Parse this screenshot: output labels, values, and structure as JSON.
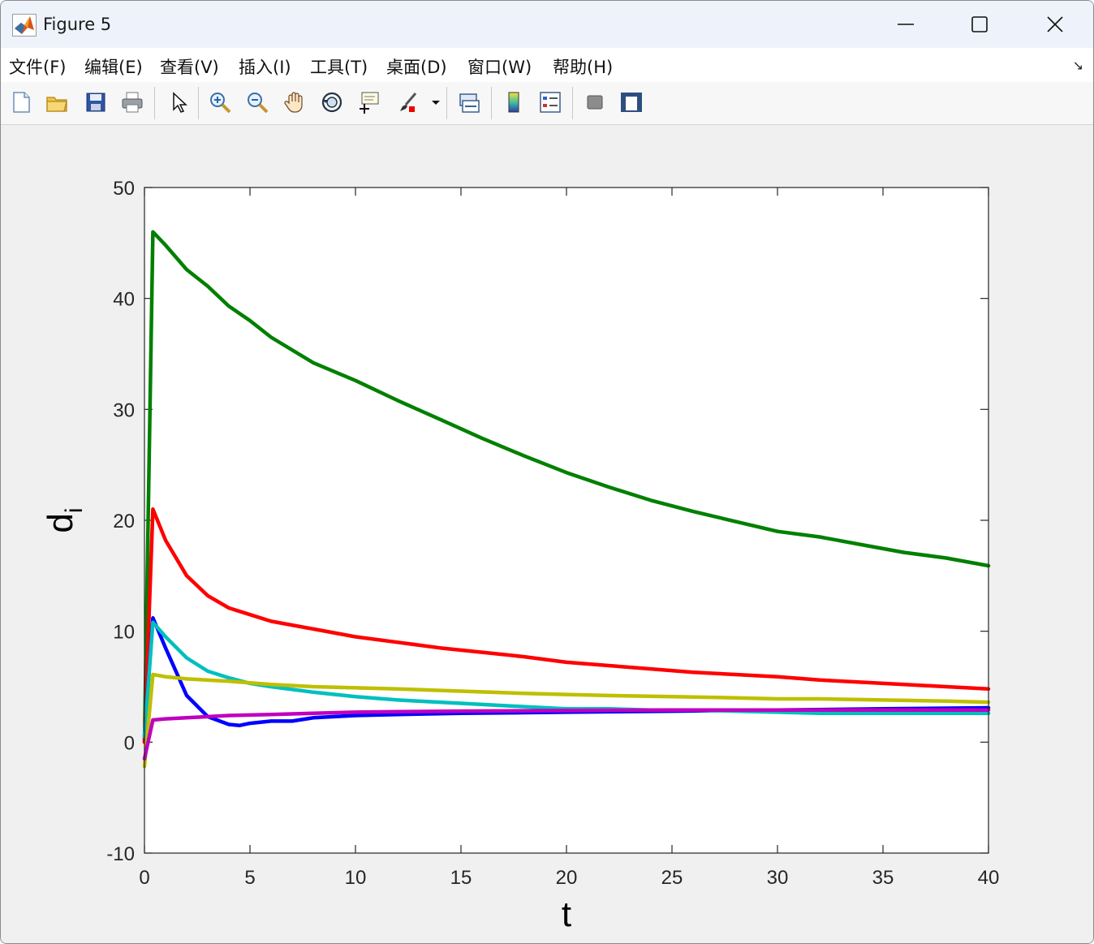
{
  "window": {
    "title": "Figure 5"
  },
  "menu": {
    "items": [
      "文件(F)",
      "编辑(E)",
      "查看(V)",
      "插入(I)",
      "工具(T)",
      "桌面(D)",
      "窗口(W)",
      "帮助(H)"
    ]
  },
  "toolbar": {
    "icons": [
      "new-figure-icon",
      "open-file-icon",
      "save-icon",
      "print-icon",
      "arrow-select-icon",
      "zoom-in-icon",
      "zoom-out-icon",
      "pan-icon",
      "rotate-3d-icon",
      "data-cursor-icon",
      "brush-icon",
      "link-plot-icon",
      "colorbar-icon",
      "legend-icon",
      "hide-plot-tools-icon",
      "show-plot-tools-icon"
    ]
  },
  "colors": {
    "green": "#008000",
    "red": "#ff0000",
    "blue": "#0000ff",
    "cyan": "#00bfbf",
    "yellow": "#bfbf00",
    "magenta": "#bf00bf"
  },
  "chart_data": {
    "type": "line",
    "xlabel": "t",
    "ylabel": "d",
    "ylabel_subscript": "i",
    "xlim": [
      0,
      40
    ],
    "ylim": [
      -10,
      50
    ],
    "xticks": [
      0,
      5,
      10,
      15,
      20,
      25,
      30,
      35,
      40
    ],
    "yticks": [
      -10,
      0,
      10,
      20,
      30,
      40,
      50
    ],
    "grid": false,
    "series": [
      {
        "color": "#008000",
        "x": [
          0,
          0.4,
          1,
          2,
          3,
          4,
          5,
          6,
          8,
          10,
          12,
          14,
          16,
          18,
          20,
          22,
          24,
          26,
          28,
          30,
          32,
          34,
          36,
          38,
          40
        ],
        "y": [
          0,
          46,
          44.8,
          42.6,
          41.1,
          39.3,
          38,
          36.5,
          34.2,
          32.6,
          30.8,
          29.1,
          27.4,
          25.8,
          24.3,
          23,
          21.8,
          20.8,
          19.9,
          19,
          18.5,
          17.8,
          17.1,
          16.6,
          15.9
        ]
      },
      {
        "color": "#ff0000",
        "x": [
          0,
          0.4,
          1,
          2,
          3,
          4,
          5,
          6,
          8,
          10,
          12,
          14,
          16,
          18,
          20,
          22,
          24,
          26,
          28,
          30,
          32,
          34,
          36,
          38,
          40
        ],
        "y": [
          0,
          21,
          18.2,
          15,
          13.2,
          12.1,
          11.5,
          10.9,
          10.2,
          9.5,
          9,
          8.5,
          8.1,
          7.7,
          7.2,
          6.9,
          6.6,
          6.3,
          6.1,
          5.9,
          5.6,
          5.4,
          5.2,
          5,
          4.8
        ]
      },
      {
        "color": "#0000ff",
        "x": [
          0,
          0.4,
          1,
          2,
          3,
          4,
          4.5,
          5,
          6,
          7,
          8,
          10,
          12,
          15,
          20,
          25,
          30,
          35,
          40
        ],
        "y": [
          0.5,
          11.2,
          8.5,
          4.2,
          2.3,
          1.6,
          1.5,
          1.7,
          1.9,
          1.9,
          2.2,
          2.4,
          2.5,
          2.6,
          2.7,
          2.8,
          2.9,
          3.0,
          3.1
        ]
      },
      {
        "color": "#00bfbf",
        "x": [
          0,
          0.4,
          1,
          2,
          3,
          4,
          5,
          6,
          8,
          10,
          12,
          14,
          16,
          18,
          20,
          22,
          24,
          26,
          28,
          30,
          32,
          34,
          36,
          38,
          40
        ],
        "y": [
          0.5,
          10.8,
          9.5,
          7.6,
          6.4,
          5.8,
          5.3,
          5,
          4.5,
          4.1,
          3.8,
          3.6,
          3.4,
          3.2,
          3,
          3,
          2.9,
          2.9,
          2.8,
          2.7,
          2.6,
          2.6,
          2.6,
          2.6,
          2.6
        ]
      },
      {
        "color": "#bfbf00",
        "x": [
          0,
          0.4,
          1,
          2,
          4,
          6,
          8,
          10,
          12,
          15,
          18,
          20,
          22,
          25,
          28,
          30,
          32,
          35,
          38,
          40
        ],
        "y": [
          -2.2,
          6.1,
          5.9,
          5.7,
          5.5,
          5.2,
          5,
          4.9,
          4.8,
          4.6,
          4.4,
          4.3,
          4.2,
          4.1,
          4,
          3.9,
          3.9,
          3.8,
          3.7,
          3.6
        ]
      },
      {
        "color": "#bf00bf",
        "x": [
          0,
          0.4,
          1,
          2,
          4,
          6,
          8,
          10,
          12,
          15,
          20,
          25,
          30,
          35,
          40
        ],
        "y": [
          -1.5,
          2,
          2.1,
          2.2,
          2.4,
          2.5,
          2.6,
          2.7,
          2.75,
          2.8,
          2.85,
          2.9,
          2.9,
          2.9,
          2.9
        ]
      }
    ]
  }
}
